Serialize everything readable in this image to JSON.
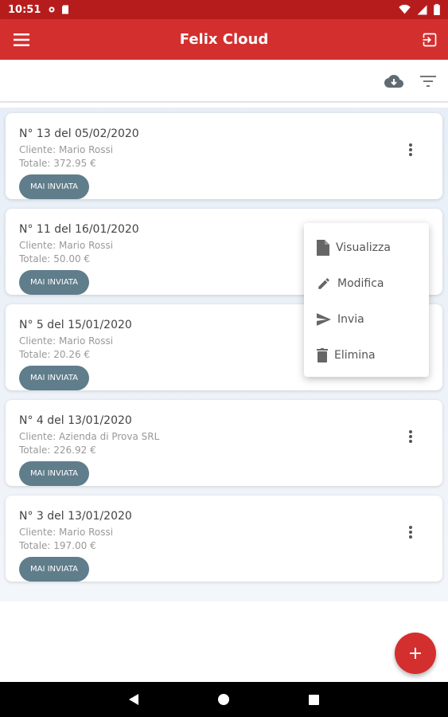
{
  "status_bar": {
    "time": "10:51"
  },
  "app_bar": {
    "title": "Felix Cloud"
  },
  "invoices": [
    {
      "heading": "N° 13 del 05/02/2020",
      "client": "Cliente: Mario Rossi",
      "total": "Totale: 372.95 €",
      "status": "MAI INVIATA"
    },
    {
      "heading": "N° 11 del 16/01/2020",
      "client": "Cliente: Mario Rossi",
      "total": "Totale: 50.00 €",
      "status": "MAI INVIATA"
    },
    {
      "heading": "N° 5 del 15/01/2020",
      "client": "Cliente: Mario Rossi",
      "total": "Totale: 20.26 €",
      "status": "MAI INVIATA"
    },
    {
      "heading": "N° 4 del 13/01/2020",
      "client": "Cliente: Azienda di Prova SRL",
      "total": "Totale: 226.92 €",
      "status": "MAI INVIATA"
    },
    {
      "heading": "N° 3 del 13/01/2020",
      "client": "Cliente: Mario Rossi",
      "total": "Totale: 197.00 €",
      "status": "MAI INVIATA"
    }
  ],
  "popup_menu": {
    "items": [
      {
        "label": "Visualizza",
        "icon": "document-icon"
      },
      {
        "label": "Modifica",
        "icon": "pencil-icon"
      },
      {
        "label": "Invia",
        "icon": "send-icon"
      },
      {
        "label": "Elimina",
        "icon": "trash-icon"
      }
    ]
  },
  "colors": {
    "primary": "#d32f2f",
    "status_bar": "#b71c1c",
    "badge": "#607d8b"
  }
}
